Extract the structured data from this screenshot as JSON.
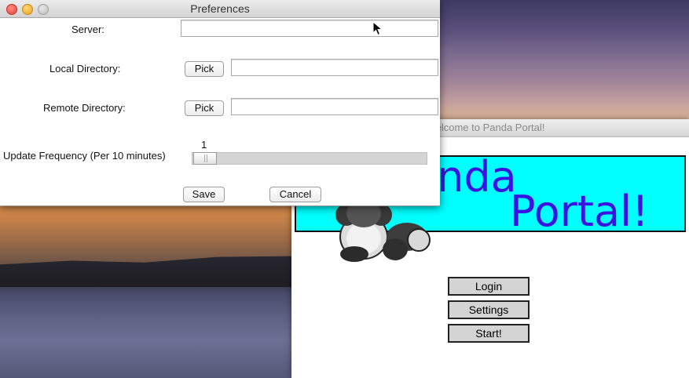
{
  "preferences": {
    "title": "Preferences",
    "server_label": "Server:",
    "server_value": "",
    "local_dir_label": "Local Directory:",
    "local_dir_value": "",
    "remote_dir_label": "Remote Directory:",
    "remote_dir_value": "",
    "pick_label": "Pick",
    "frequency_label": "Update Frequency (Per 10 minutes)",
    "frequency_value": "1",
    "frequency_fraction": 0.0,
    "save_label": "Save",
    "cancel_label": "Cancel"
  },
  "panda_portal": {
    "title": "elcome to Panda Portal!",
    "banner_line1": "anda",
    "banner_line2": "Portal!",
    "buttons": [
      "Login",
      "Settings",
      "Start!"
    ]
  },
  "colors": {
    "banner_bg": "#00ffff",
    "banner_text": "#3a13e0",
    "button_bg": "#d4d4d4"
  }
}
